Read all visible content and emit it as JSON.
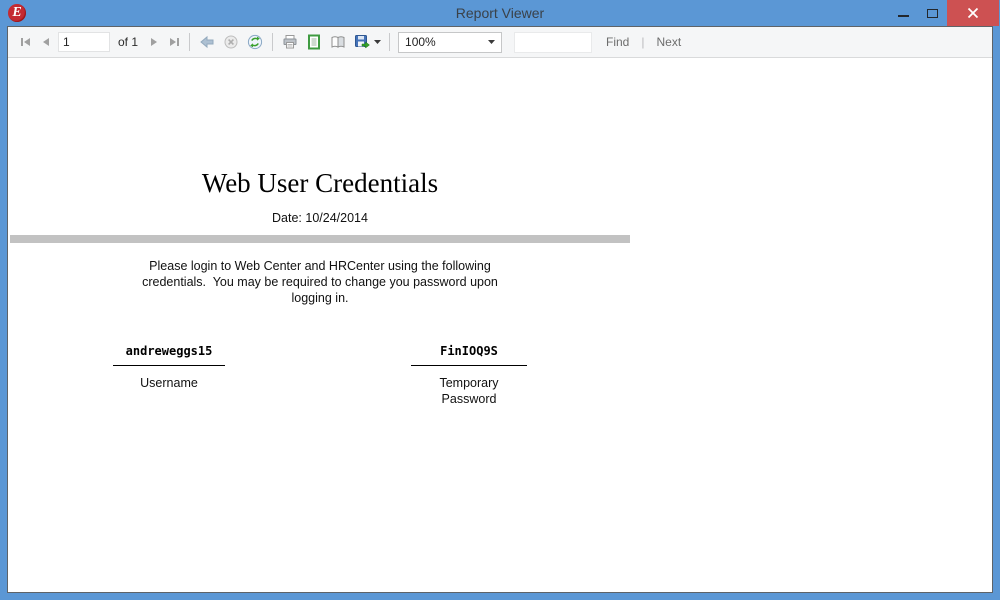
{
  "window": {
    "title": "Report Viewer",
    "logo_letter": "E"
  },
  "toolbar": {
    "page_number": "1",
    "of_label": "of 1",
    "zoom_value": "100%",
    "find_value": "",
    "find_label": "Find",
    "next_label": "Next",
    "separator": "|",
    "icons": [
      {
        "name": "first-page-icon",
        "enabled": false
      },
      {
        "name": "previous-page-icon",
        "enabled": false
      },
      {
        "name": "next-page-icon",
        "enabled": false
      },
      {
        "name": "last-page-icon",
        "enabled": false
      },
      {
        "name": "back-to-parent-icon",
        "enabled": false
      },
      {
        "name": "stop-rendering-icon",
        "enabled": false
      },
      {
        "name": "refresh-icon",
        "enabled": true
      },
      {
        "name": "print-icon",
        "enabled": true
      },
      {
        "name": "print-layout-icon",
        "enabled": true
      },
      {
        "name": "page-setup-icon",
        "enabled": true
      },
      {
        "name": "export-icon",
        "enabled": true
      }
    ]
  },
  "report": {
    "title": "Web User Credentials",
    "date": "Date: 10/24/2014",
    "instructions": "Please login to Web Center and HRCenter using the following\ncredentials.  You may be required to change you password upon\nlogging in.",
    "username": {
      "value": "andreweggs15",
      "label": "Username"
    },
    "password": {
      "value": "FinIOQ9S",
      "label": "Temporary\nPassword"
    }
  },
  "colors": {
    "titlebar": "#5b97d5",
    "close_button": "#cd5152",
    "divider_bar": "#c2c2c2",
    "logo_red": "#c42b33",
    "disabled_icon": "#a0a0a0"
  }
}
